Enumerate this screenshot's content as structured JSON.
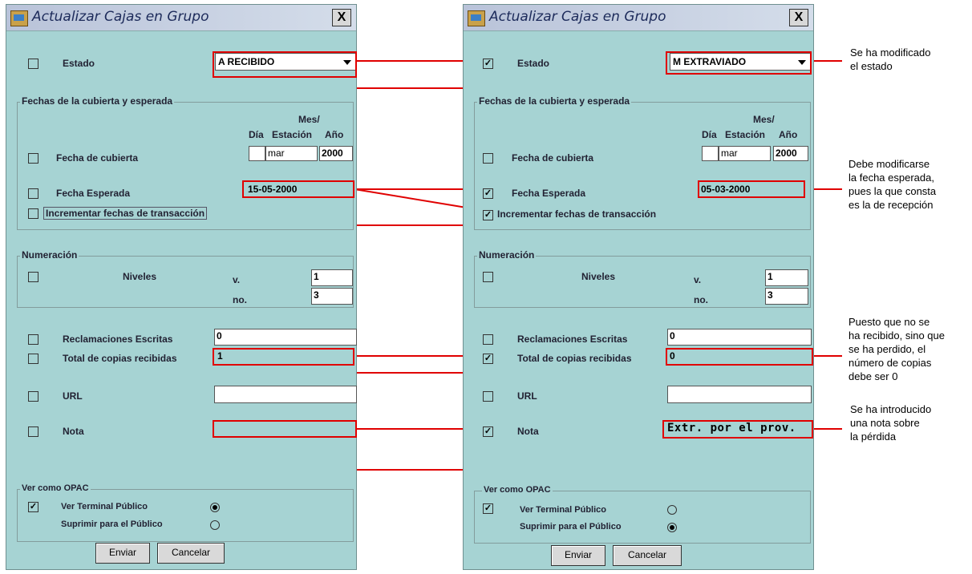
{
  "dialog_title": "Actualizar Cajas en Grupo",
  "close_label": "X",
  "estado_label": "Estado",
  "fechas_group_title": "Fechas de la cubierta y esperada",
  "mes_header": "Mes/",
  "dia_header": "Día",
  "estacion_header": "Estación",
  "anio_header": "Año",
  "fecha_cubierta_label": "Fecha de cubierta",
  "fecha_esperada_label": "Fecha Esperada",
  "incrementar_label": "Incrementar fechas de transacción",
  "numeracion_group_title": "Numeración",
  "niveles_label": "Niveles",
  "v_label": "v.",
  "no_label": "no.",
  "reclamaciones_label": "Reclamaciones Escritas",
  "total_copias_label": "Total de copias recibidas",
  "url_label": "URL",
  "nota_label": "Nota",
  "opac_group_title": "Ver como OPAC",
  "ver_terminal_label": "Ver Terminal Público",
  "suprimir_label": "Suprimir para el Público",
  "enviar_label": "Enviar",
  "cancelar_label": "Cancelar",
  "left": {
    "estado_checked": false,
    "estado_value": "A  RECIBIDO",
    "cubierta_checked": false,
    "cubierta_dia": "",
    "cubierta_mes": "mar",
    "cubierta_anio": "2000",
    "esperada_checked": false,
    "fecha_esperada": "15-05-2000",
    "incrementar_checked": false,
    "niveles_checked": false,
    "v_value": "1",
    "no_value": "3",
    "reclamaciones_checked": false,
    "reclamaciones_value": "0",
    "total_checked": false,
    "total_value": "1",
    "url_checked": false,
    "url_value": "",
    "nota_checked": false,
    "nota_value": "",
    "ver_terminal_checked": true,
    "radio_ver_selected": true,
    "radio_suprimir_selected": false
  },
  "right": {
    "estado_checked": true,
    "estado_value": "M  EXTRAVIADO",
    "cubierta_checked": false,
    "cubierta_dia": "",
    "cubierta_mes": "mar",
    "cubierta_anio": "2000",
    "esperada_checked": true,
    "fecha_esperada": "05-03-2000",
    "incrementar_checked": true,
    "niveles_checked": false,
    "v_value": "1",
    "no_value": "3",
    "reclamaciones_checked": false,
    "reclamaciones_value": "0",
    "total_checked": true,
    "total_value": "0",
    "url_checked": false,
    "url_value": "",
    "nota_checked": true,
    "nota_value": "Extr. por el prov.",
    "ver_terminal_checked": true,
    "radio_ver_selected": false,
    "radio_suprimir_selected": true
  },
  "annotations": {
    "estado": "Se ha modificado\nel estado",
    "fecha": "Debe modificarse\nla fecha esperada,\npues la que consta\nes la de recepción",
    "copias": "Puesto que no se\nha recibido, sino que\nse ha perdido, el\nnúmero de copias\ndebe ser 0",
    "nota": "Se ha introducido\nuna nota sobre\nla pérdida"
  },
  "colors": {
    "dialog_bg": "#a6d3d3",
    "highlight_red": "#e00000"
  }
}
